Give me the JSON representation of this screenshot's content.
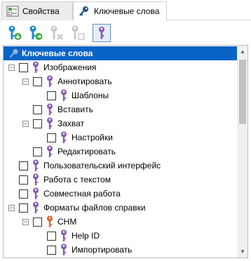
{
  "tabs": [
    {
      "label": "Свойства",
      "icon": "properties-icon"
    },
    {
      "label": "Ключевые слова",
      "icon": "key-icon",
      "active": true
    }
  ],
  "toolbar": {
    "buttons": [
      {
        "name": "add-keyword",
        "icon": "key-add-icon",
        "enabled": true
      },
      {
        "name": "add-sub-keyword",
        "icon": "key-arrow-icon",
        "enabled": true
      },
      {
        "name": "delete-keyword",
        "icon": "key-delete-icon",
        "enabled": false
      },
      {
        "name": "toggle-keyword",
        "icon": "key-checkbox-icon",
        "enabled": false
      },
      {
        "name": "keyword-view",
        "icon": "key-frame-icon",
        "enabled": true,
        "pressed": true
      }
    ]
  },
  "tree": {
    "header": "Ключевые слова",
    "items": [
      {
        "label": "Изображения",
        "expandable": true,
        "expanded": true
      },
      {
        "label": "Аннотировать",
        "expandable": true,
        "expanded": true
      },
      {
        "label": "Шаблоны"
      },
      {
        "label": "Вставить"
      },
      {
        "label": "Захват",
        "expandable": true,
        "expanded": true
      },
      {
        "label": "Настройки"
      },
      {
        "label": "Редактировать"
      },
      {
        "label": "Пользовательский интерфейс"
      },
      {
        "label": "Работа с текстом"
      },
      {
        "label": "Совместная работа"
      },
      {
        "label": "Форматы файлов справки",
        "expandable": true,
        "expanded": true
      },
      {
        "label": "CHM",
        "expandable": true,
        "expanded": true,
        "key_color": "orange"
      },
      {
        "label": "Help ID"
      },
      {
        "label": "Импортировать"
      }
    ]
  },
  "colors": {
    "selection": "#0a64c8",
    "key_purple": "#8a5cae",
    "key_orange": "#e0622a",
    "key_blue": "#1e88d6"
  }
}
